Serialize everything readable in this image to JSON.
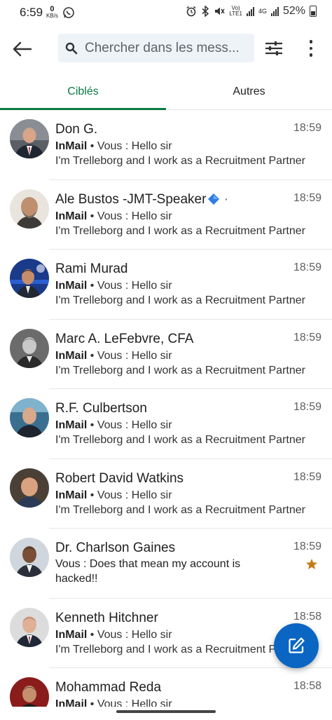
{
  "status_bar": {
    "time": "6:59",
    "data_speed_value": "0",
    "data_speed_unit": "KB/s",
    "volte": "Vo)",
    "lte": "LTE1",
    "network": "4G",
    "battery": "52%"
  },
  "search": {
    "placeholder": "Chercher dans les mess..."
  },
  "tabs": [
    {
      "label": "Ciblés"
    },
    {
      "label": "Autres"
    }
  ],
  "conversations": [
    {
      "name": "Don G.",
      "time": "18:59",
      "type_label": "InMail",
      "preview": " • Vous : Hello sir",
      "snippet": "I'm Trelleborg and I work as a Recruitment Partner"
    },
    {
      "name": "Ale Bustos -JMT-Speaker",
      "suffix": "·",
      "time": "18:59",
      "type_label": "InMail",
      "preview": " • Vous : Hello sir",
      "snippet": "I'm Trelleborg and I work as a Recruitment Partner"
    },
    {
      "name": "Rami Murad",
      "time": "18:59",
      "type_label": "InMail",
      "preview": " • Vous : Hello sir",
      "snippet": "I'm Trelleborg and I work as a Recruitment Partner"
    },
    {
      "name": "Marc A. LeFebvre, CFA",
      "time": "18:59",
      "type_label": "InMail",
      "preview": " • Vous : Hello sir",
      "snippet": "I'm Trelleborg and I work as a Recruitment Partner"
    },
    {
      "name": "R.F. Culbertson",
      "time": "18:59",
      "type_label": "InMail",
      "preview": " • Vous : Hello sir",
      "snippet": "I'm Trelleborg and I work as a Recruitment Partner"
    },
    {
      "name": "Robert David Watkins",
      "time": "18:59",
      "type_label": "InMail",
      "preview": " • Vous : Hello sir",
      "snippet": "I'm Trelleborg and I work as a Recruitment Partner"
    },
    {
      "name": "Dr. Charlson Gaines",
      "time": "18:59",
      "message": "Vous : Does that mean my account is hacked!!",
      "starred": true
    },
    {
      "name": "Kenneth Hitchner",
      "time": "18:58",
      "type_label": "InMail",
      "preview": " • Vous : Hello sir",
      "snippet": "I'm Trelleborg and I work as a Recruitment Partner"
    },
    {
      "name": "Mohammad Reda",
      "time": "18:58",
      "type_label": "InMail",
      "preview": " • Vous : Hello sir"
    }
  ],
  "colors": {
    "accent_green": "#0a7a42",
    "fab_blue": "#0a66c2",
    "star": "#c37d16"
  },
  "icons": {
    "back": "arrow-left-icon",
    "search": "search-icon",
    "filter": "sliders-icon",
    "more": "more-vertical-icon",
    "compose": "compose-icon",
    "star": "star-icon",
    "verified": "diamond-icon"
  }
}
